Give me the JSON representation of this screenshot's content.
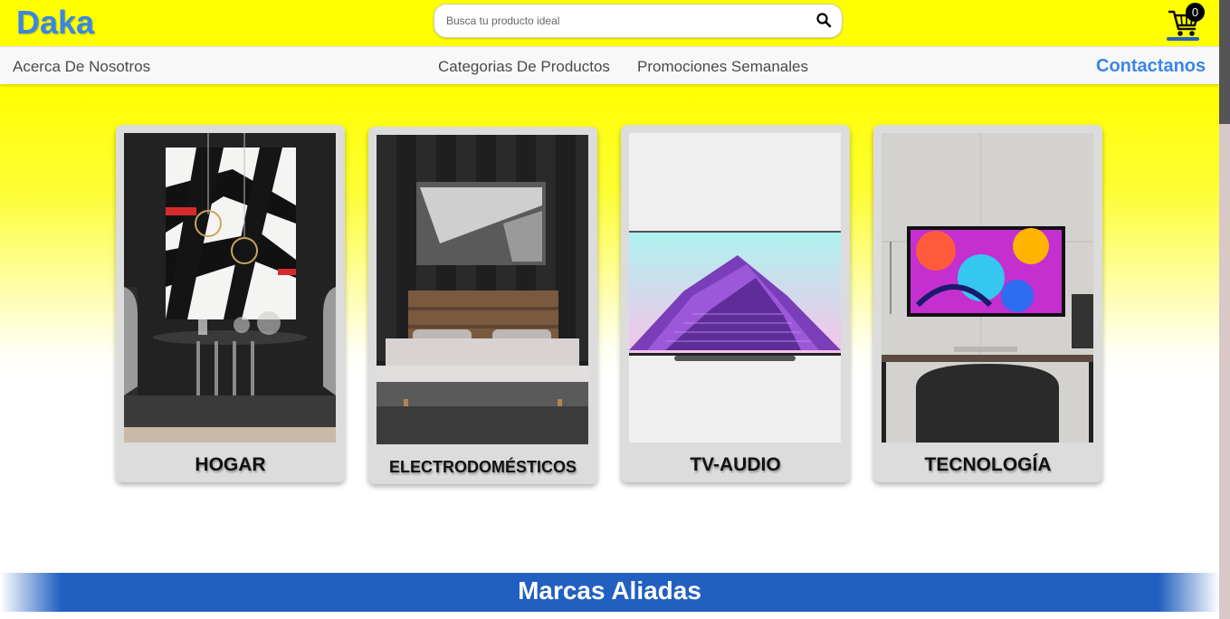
{
  "header": {
    "logo": "Daka",
    "search_placeholder": "Busca tu producto ideal",
    "cart_count": "0"
  },
  "nav": {
    "about": "Acerca De Nosotros",
    "categories": "Categorias De Productos",
    "promotions": "Promociones Semanales",
    "contact": "Contactanos"
  },
  "categories": [
    {
      "label": "HOGAR"
    },
    {
      "label": "ELECTRODOMÉSTICOS"
    },
    {
      "label": "TV-AUDIO"
    },
    {
      "label": "TECNOLOGÍA"
    }
  ],
  "brands": {
    "title": "Marcas Aliadas"
  },
  "colors": {
    "header_bg": "#ffff00",
    "brand_blue": "#3a86e8",
    "banner_blue": "#2160c0"
  }
}
